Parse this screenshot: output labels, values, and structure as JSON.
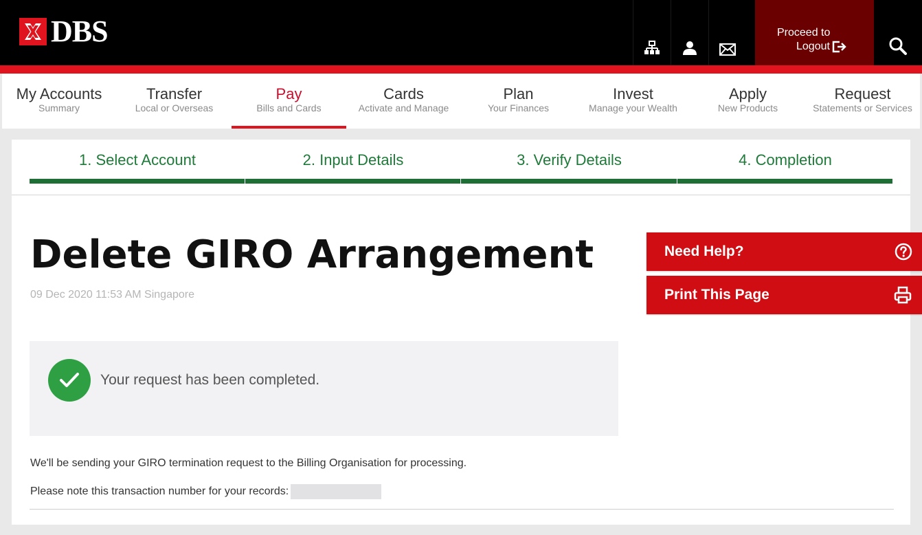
{
  "brand": {
    "name": "DBS",
    "logo_color": "#e0141e"
  },
  "header": {
    "icons": [
      "sitemap-icon",
      "user-icon",
      "mail-icon",
      "search-icon"
    ],
    "logout_line1": "Proceed to",
    "logout_line2": "Logout"
  },
  "nav": {
    "items": [
      {
        "title": "My Accounts",
        "subtitle": "Summary"
      },
      {
        "title": "Transfer",
        "subtitle": "Local or Overseas"
      },
      {
        "title": "Pay",
        "subtitle": "Bills and Cards"
      },
      {
        "title": "Cards",
        "subtitle": "Activate and Manage"
      },
      {
        "title": "Plan",
        "subtitle": "Your Finances"
      },
      {
        "title": "Invest",
        "subtitle": "Manage your Wealth"
      },
      {
        "title": "Apply",
        "subtitle": "New Products"
      },
      {
        "title": "Request",
        "subtitle": "Statements or Services"
      }
    ],
    "active": "Pay"
  },
  "steps": [
    {
      "label": "1. Select Account"
    },
    {
      "label": "2. Input Details"
    },
    {
      "label": "3. Verify Details"
    },
    {
      "label": "4. Completion"
    }
  ],
  "main": {
    "title": "Delete GIRO Arrangement",
    "timestamp": "09 Dec 2020 11:53 AM Singapore",
    "status_message": "Your request has been completed.",
    "note": "We'll be sending your GIRO termination request to the Billing Organisation for processing.",
    "txn_label": "Please note this transaction number for your records:"
  },
  "side": {
    "help_label": "Need Help?",
    "print_label": "Print This Page"
  },
  "colors": {
    "accent_red": "#e0141e",
    "step_green": "#1e6e35",
    "success_green": "#2ea043"
  }
}
